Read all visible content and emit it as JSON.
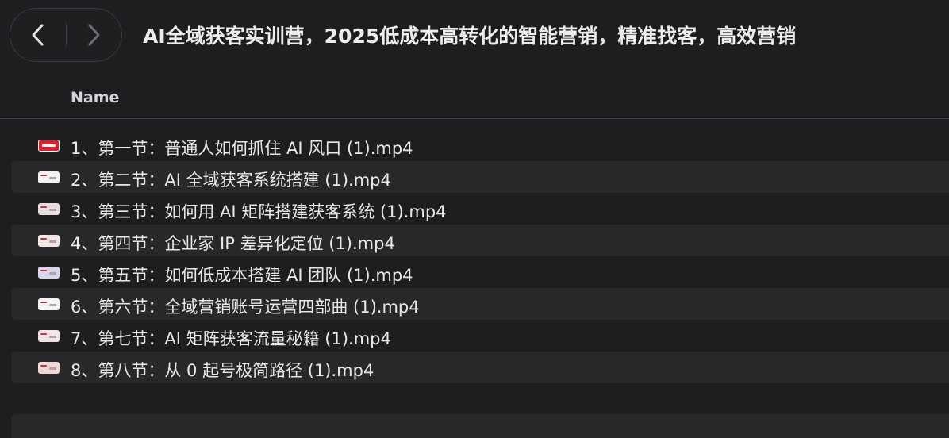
{
  "window": {
    "title": "AI全域获客实训营，2025低成本高转化的智能营销，精准找客，高效营销"
  },
  "toolbar": {
    "back_icon": "chevron-left-icon",
    "forward_icon": "chevron-right-icon"
  },
  "list": {
    "column_name": "Name",
    "files": [
      {
        "label": "1、第一节：普通人如何抓住 AI 风口 (1).mp4",
        "icon_color": "#d8232f",
        "icon_style": "solid"
      },
      {
        "label": "2、第二节：AI 全域获客系统搭建 (1).mp4",
        "icon_color": "#f2f2f2",
        "icon_style": "light"
      },
      {
        "label": "3、第三节：如何用 AI 矩阵搭建获客系统 (1).mp4",
        "icon_color": "#e8dede",
        "icon_style": "light"
      },
      {
        "label": "4、第四节：企业家 IP 差异化定位 (1).mp4",
        "icon_color": "#f0e6e6",
        "icon_style": "light"
      },
      {
        "label": "5、第五节：如何低成本搭建 AI 团队 (1).mp4",
        "icon_color": "#d9d6ee",
        "icon_style": "light"
      },
      {
        "label": "6、第六节：全域营销账号运营四部曲 (1).mp4",
        "icon_color": "#f4f4f4",
        "icon_style": "light"
      },
      {
        "label": "7、第七节：AI 矩阵获客流量秘籍 (1).mp4",
        "icon_color": "#f2e4e4",
        "icon_style": "light"
      },
      {
        "label": "8、第八节：从 0 起号极简路径 (1).mp4",
        "icon_color": "#f0d8d8",
        "icon_style": "light"
      }
    ]
  },
  "colors": {
    "background": "#1e1e21",
    "row_alt": "#28282b",
    "accent_red": "#d8232f"
  }
}
